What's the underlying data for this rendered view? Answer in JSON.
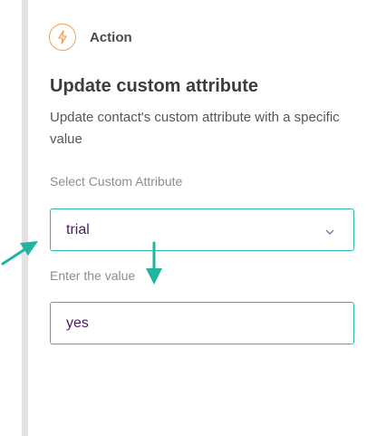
{
  "header": {
    "icon": "lightning-icon",
    "label": "Action"
  },
  "panel": {
    "title": "Update custom attribute",
    "description": "Update contact's custom attribute with a specific value"
  },
  "attribute_field": {
    "label": "Select Custom Attribute",
    "value": "trial",
    "icon": "chevron-down-icon"
  },
  "value_field": {
    "label": "Enter the value",
    "value": "yes"
  },
  "colors": {
    "accent": "#2eb6ad",
    "action_icon": "#f0a05a",
    "value_text": "#4b1b60",
    "annotation_arrow": "#1fb5a0"
  }
}
